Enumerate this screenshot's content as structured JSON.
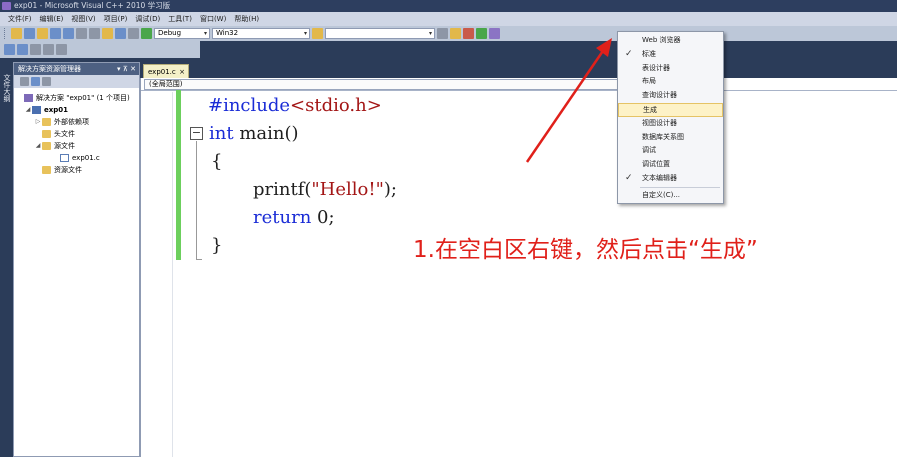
{
  "window": {
    "title": "exp01 - Microsoft Visual C++ 2010 学习版"
  },
  "menu": [
    "文件(F)",
    "编辑(E)",
    "视图(V)",
    "项目(P)",
    "调试(D)",
    "工具(T)",
    "窗口(W)",
    "帮助(H)"
  ],
  "toolbar": {
    "config": "Debug",
    "platform": "Win32",
    "search": ""
  },
  "side_strip": {
    "label": "文件大纲"
  },
  "solution_explorer": {
    "title": "解决方案资源管理器",
    "controls": "▾ ⊼ ✕",
    "tree": [
      {
        "label": "解决方案 \"exp01\" (1 个项目)",
        "depth": 0,
        "icon": "solution-icon"
      },
      {
        "label": "exp01",
        "depth": 1,
        "icon": "project-icon",
        "bold": true
      },
      {
        "label": "外部依赖项",
        "depth": 2,
        "icon": "folder-icon"
      },
      {
        "label": "头文件",
        "depth": 2,
        "icon": "folder-icon"
      },
      {
        "label": "源文件",
        "depth": 2,
        "icon": "folder-icon"
      },
      {
        "label": "exp01.c",
        "depth": 3,
        "icon": "c-file-icon"
      },
      {
        "label": "资源文件",
        "depth": 2,
        "icon": "folder-icon"
      }
    ]
  },
  "editor": {
    "tab": "exp01.c",
    "tab_close": "×",
    "scope": "(全局范围)",
    "code": {
      "include_kw": "#include",
      "include_rest": "<stdio.h>",
      "int_kw": "int",
      "main_rest": " main()",
      "open_brace": "{",
      "printf_name": "printf(",
      "printf_str": "\"Hello!\"",
      "printf_end": ");",
      "return_kw": "return",
      "return_rest": " 0;",
      "close_brace": "}"
    }
  },
  "context_menu": {
    "items": [
      {
        "label": "Web 浏览器",
        "checked": false
      },
      {
        "label": "标准",
        "checked": true
      },
      {
        "label": "表设计器",
        "checked": false
      },
      {
        "label": "布局",
        "checked": false
      },
      {
        "label": "查询设计器",
        "checked": false
      },
      {
        "label": "生成",
        "checked": false,
        "highlighted": true
      },
      {
        "label": "视图设计器",
        "checked": false
      },
      {
        "label": "数据库关系图",
        "checked": false
      },
      {
        "label": "调试",
        "checked": false
      },
      {
        "label": "调试位置",
        "checked": false
      },
      {
        "label": "文本编辑器",
        "checked": true
      },
      {
        "label": "自定义(C)...",
        "checked": false,
        "separator_before": true
      }
    ]
  },
  "annotation": {
    "text": "1.在空白区右键，然后点击“生成”",
    "color": "#e0201a"
  }
}
